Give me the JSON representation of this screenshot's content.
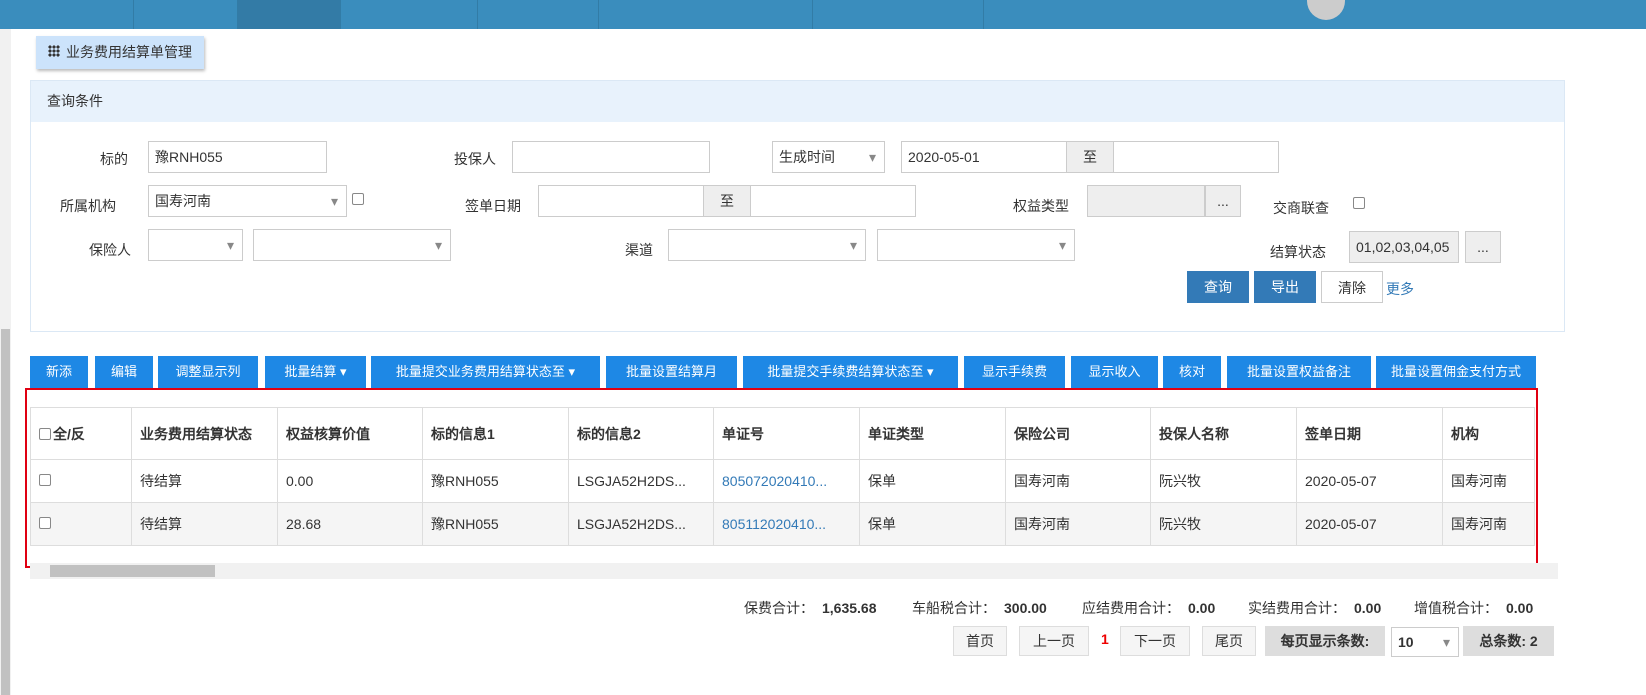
{
  "breadcrumb": "业务费用结算单管理",
  "query": {
    "title": "查询条件",
    "subject_label": "标的",
    "subject_value": "豫RNH055",
    "applicant_label": "投保人",
    "applicant_value": "",
    "time_type": "生成时间",
    "date_from": "2020-05-01",
    "to": "至",
    "date_to": "",
    "org_label": "所属机构",
    "org_value": "国寿河南",
    "sign_label": "签单日期",
    "sign_to": "至",
    "equity_label": "权益类型",
    "more_dots": "...",
    "cross_label": "交商联查",
    "insurer_label": "保险人",
    "channel_label": "渠道",
    "status_label": "结算状态",
    "status_value": "01,02,03,04,05",
    "search": "查询",
    "export": "导出",
    "clear": "清除",
    "more": "更多"
  },
  "toolbar": [
    "新添",
    "编辑",
    "调整显示列",
    "批量结算 ▾",
    "批量提交业务费用结算状态至 ▾",
    "批量设置结算月",
    "批量提交手续费结算状态至 ▾",
    "显示手续费",
    "显示收入",
    "核对",
    "批量设置权益备注",
    "批量设置佣金支付方式"
  ],
  "table": {
    "headers": [
      "全/反",
      "业务费用结算状态",
      "权益核算价值",
      "标的信息1",
      "标的信息2",
      "单证号",
      "单证类型",
      "保险公司",
      "投保人名称",
      "签单日期",
      "机构"
    ],
    "rows": [
      [
        "待结算",
        "0.00",
        "豫RNH055",
        "LSGJA52H2DS...",
        "805072020410...",
        "保单",
        "国寿河南",
        "阮兴牧",
        "2020-05-07",
        "国寿河南"
      ],
      [
        "待结算",
        "28.68",
        "豫RNH055",
        "LSGJA52H2DS...",
        "805112020410...",
        "保单",
        "国寿河南",
        "阮兴牧",
        "2020-05-07",
        "国寿河南"
      ]
    ]
  },
  "summary": {
    "premium_label": "保费合计：",
    "premium": "1,635.68",
    "vessel_label": "车船税合计：",
    "vessel": "300.00",
    "payable_label": "应结费用合计：",
    "payable": "0.00",
    "actual_label": "实结费用合计：",
    "actual": "0.00",
    "vat_label": "增值税合计：",
    "vat": "0.00"
  },
  "pager": {
    "first": "首页",
    "prev": "上一页",
    "current": "1",
    "next": "下一页",
    "last": "尾页",
    "per_page_label": "每页显示条数:",
    "per_page": "10",
    "total": "总条数: 2"
  }
}
